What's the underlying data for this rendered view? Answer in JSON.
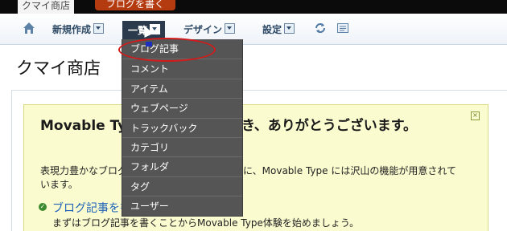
{
  "topbar": {
    "site_name": "クマイ商店",
    "write_button": "ブログを書く"
  },
  "nav": {
    "home_icon": "home-icon",
    "items": [
      {
        "label": "新規作成"
      },
      {
        "label": "一覧"
      },
      {
        "label": "デザイン"
      },
      {
        "label": "設定"
      }
    ],
    "refresh_icon": "refresh-icon",
    "view_icon": "view-icon"
  },
  "page": {
    "title": "クマイ商店"
  },
  "welcome": {
    "title": "Movable Typeをご利用いただき、ありがとうございます。",
    "body": "表現力豊かなブログやウェブサイトを作るために、Movable Type には沢山の機能が用意されています。",
    "link_label": "ブログ記事を書く",
    "link_sub": "まずはブログ記事を書くことからMovable Type体験を始めましょう。"
  },
  "dropdown": {
    "items": [
      "ブログ記事",
      "コメント",
      "アイテム",
      "ウェブページ",
      "トラックバック",
      "カテゴリ",
      "フォルダ",
      "タグ",
      "ユーザー"
    ],
    "highlighted": "ブログ記事"
  },
  "colors": {
    "topbar_bg": "#0b0b0b",
    "write_button_bg": "#b43a10",
    "nav_text": "#2e4a66",
    "menu_bg": "#555555",
    "welcome_bg": "#fbfbd0",
    "highlight_ring": "#d11b1b"
  }
}
